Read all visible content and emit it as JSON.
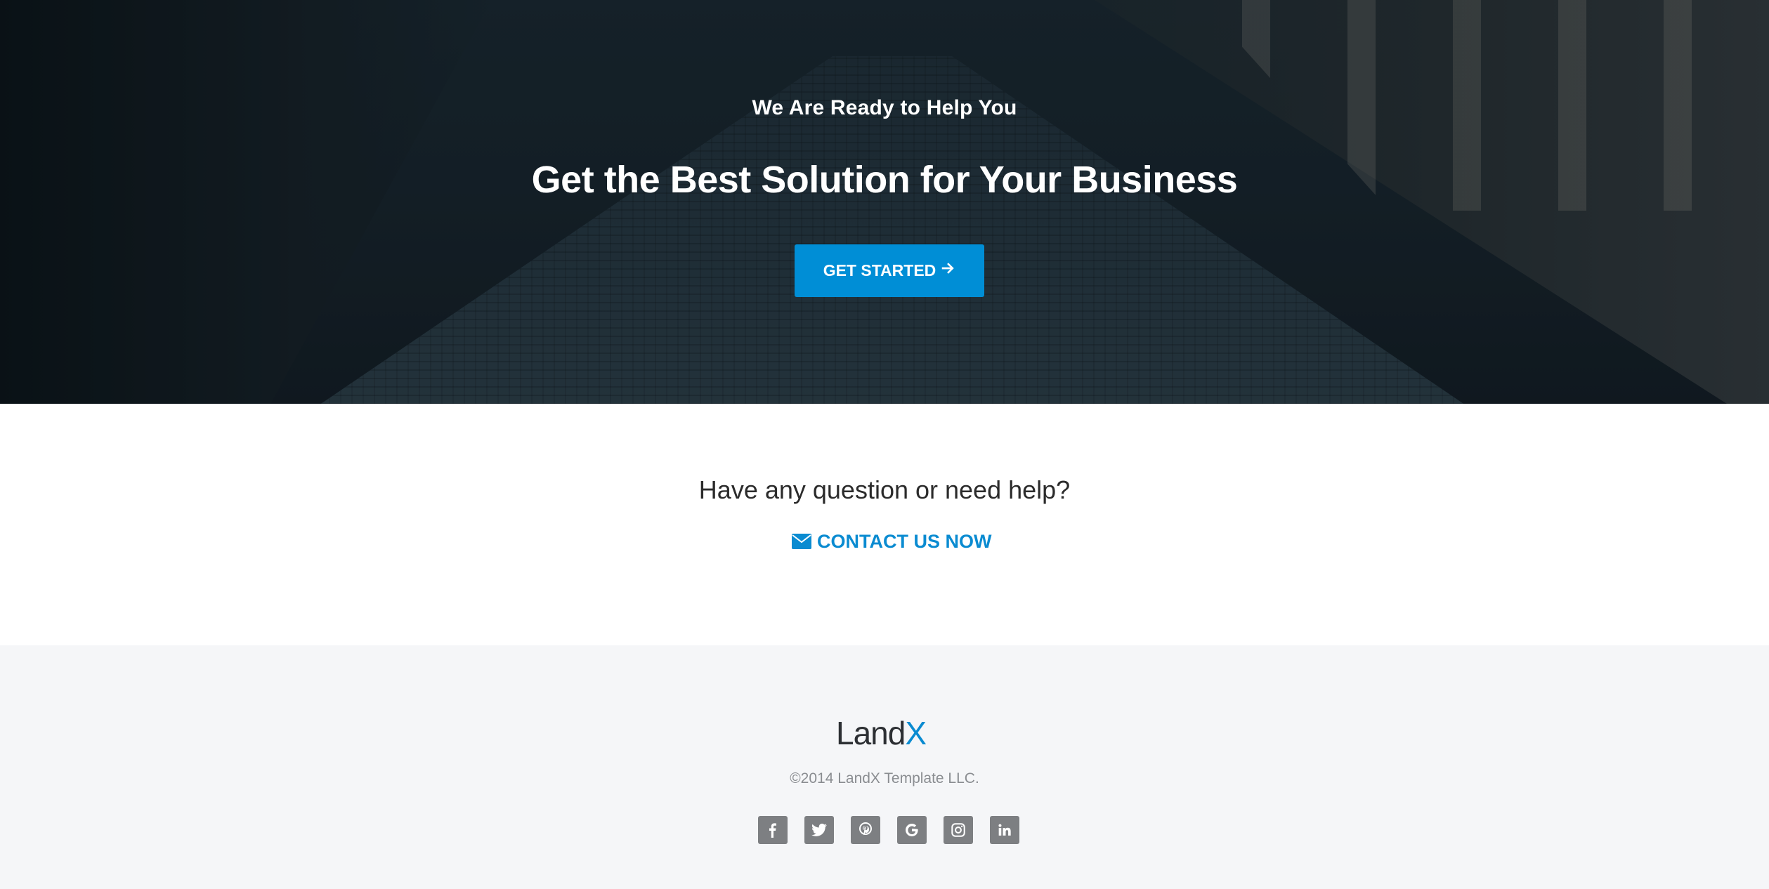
{
  "hero": {
    "subtitle": "We Are Ready to Help You",
    "title": "Get the Best Solution for Your Business",
    "cta_label": "GET STARTED",
    "cta_icon": "arrow-right-icon"
  },
  "help": {
    "question": "Have any question or need help?",
    "contact_label": "CONTACT US NOW",
    "contact_icon": "envelope-icon"
  },
  "footer": {
    "logo": {
      "main": "Land",
      "accent": "X"
    },
    "copyright": "©2014 LandX Template LLC.",
    "socials": [
      "facebook-icon",
      "twitter-icon",
      "pinterest-icon",
      "google-icon",
      "instagram-icon",
      "linkedin-icon"
    ]
  },
  "colors": {
    "accent": "#008ed6",
    "link": "#0a8bd1",
    "footer_bg": "#f5f6f8",
    "social_bg": "#7d7f82"
  }
}
